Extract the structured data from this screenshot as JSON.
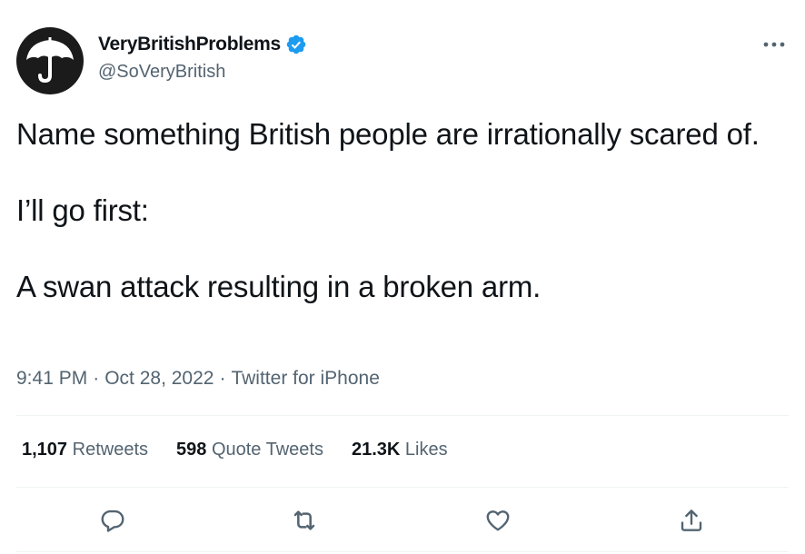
{
  "user": {
    "display_name": "VeryBritishProblems",
    "handle": "@SoVeryBritish",
    "verified": true,
    "avatar_icon": "umbrella-icon"
  },
  "tweet": {
    "lines": [
      "Name something British people are irrationally scared of.",
      "I’ll go first:",
      "A swan attack resulting in a broken arm."
    ],
    "time": "9:41 PM",
    "date": "Oct 28, 2022",
    "source": "Twitter for iPhone",
    "separator": "·"
  },
  "stats": {
    "retweets_count": "1,107",
    "retweets_label": "Retweets",
    "quotes_count": "598",
    "quotes_label": "Quote Tweets",
    "likes_count": "21.3K",
    "likes_label": "Likes"
  },
  "icons": {
    "more": "more-dots-icon",
    "reply": "reply-icon",
    "retweet": "retweet-icon",
    "like": "heart-icon",
    "share": "share-icon",
    "verified": "verified-badge-icon"
  },
  "colors": {
    "text": "#0f1419",
    "secondary": "#536471",
    "verified": "#1d9bf0",
    "divider": "#eff3f4"
  }
}
